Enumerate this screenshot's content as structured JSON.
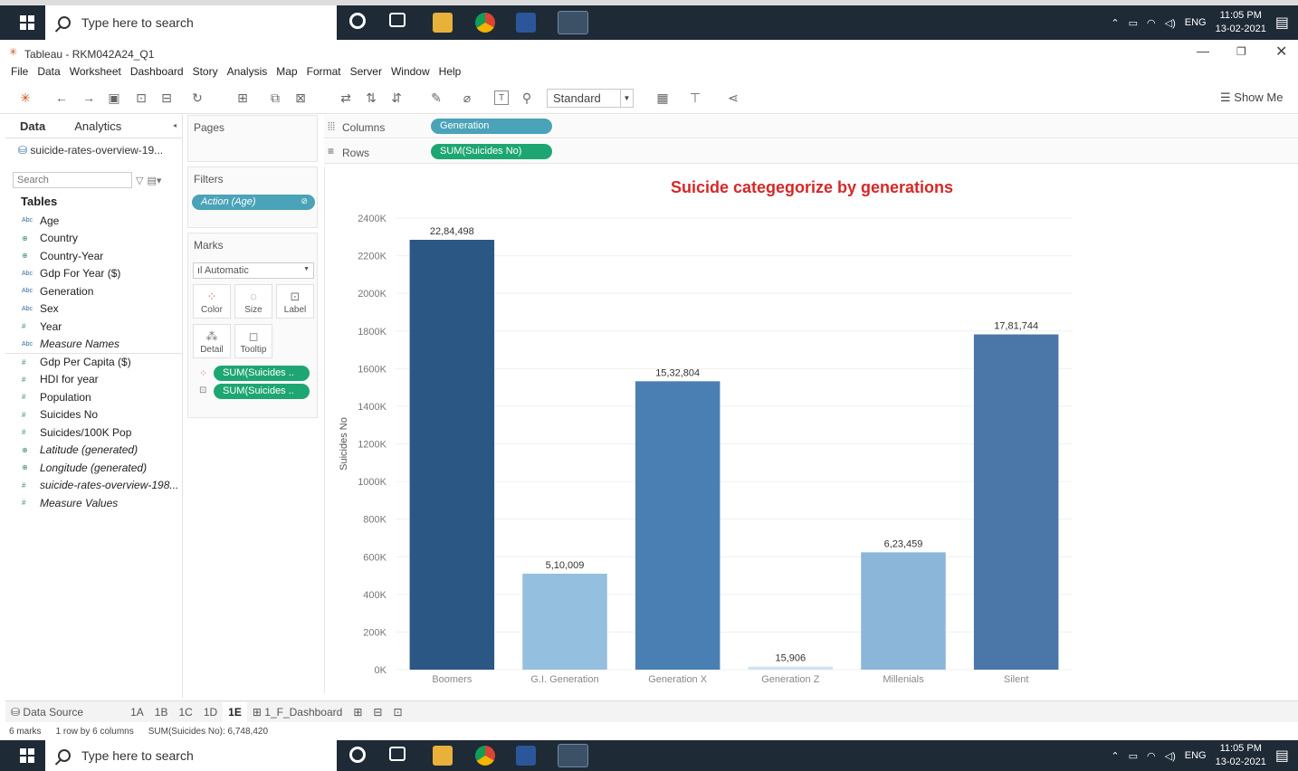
{
  "taskbar": {
    "search_placeholder": "Type here to search",
    "lang": "ENG",
    "time": "11:05 PM",
    "date": "13-02-2021"
  },
  "window": {
    "title": "Tableau - RKM042A24_Q1"
  },
  "menu": [
    "File",
    "Data",
    "Worksheet",
    "Dashboard",
    "Story",
    "Analysis",
    "Map",
    "Format",
    "Server",
    "Window",
    "Help"
  ],
  "toolbar": {
    "fit_select": "Standard",
    "show_me": "Show Me"
  },
  "data_pane": {
    "tab_data": "Data",
    "tab_analytics": "Analytics",
    "source": "suicide-rates-overview-19...",
    "search_placeholder": "Search",
    "tables_heading": "Tables",
    "fields": [
      {
        "type": "Abc",
        "name": "Age"
      },
      {
        "type": "globe",
        "name": "Country"
      },
      {
        "type": "globe",
        "name": "Country-Year"
      },
      {
        "type": "Abc",
        "name": "Gdp For Year ($)"
      },
      {
        "type": "Abc",
        "name": "Generation"
      },
      {
        "type": "Abc",
        "name": "Sex"
      },
      {
        "type": "#",
        "name": "Year"
      },
      {
        "type": "Abc",
        "name": "Measure Names"
      },
      {
        "type": "#",
        "name": "Gdp Per Capita ($)"
      },
      {
        "type": "#",
        "name": "HDI for year"
      },
      {
        "type": "#",
        "name": "Population"
      },
      {
        "type": "#",
        "name": "Suicides No"
      },
      {
        "type": "#",
        "name": "Suicides/100K Pop"
      },
      {
        "type": "globe",
        "name": "Latitude (generated)"
      },
      {
        "type": "globe",
        "name": "Longitude (generated)"
      },
      {
        "type": "#",
        "name": "suicide-rates-overview-198..."
      },
      {
        "type": "#",
        "name": "Measure Values"
      }
    ]
  },
  "shelves": {
    "pages_label": "Pages",
    "filters_label": "Filters",
    "filter_pill": "Action (Age)",
    "marks_label": "Marks",
    "marks_type": "Automatic",
    "mark_buttons": [
      "Color",
      "Size",
      "Label",
      "Detail",
      "Tooltip"
    ],
    "mark_pill_1": "SUM(Suicides ..",
    "mark_pill_2": "SUM(Suicides ..",
    "columns_label": "Columns",
    "rows_label": "Rows",
    "columns_pill": "Generation",
    "rows_pill": "SUM(Suicides No)"
  },
  "chart_data": {
    "type": "bar",
    "title": "Suicide categegorize by generations",
    "ylabel": "Suicides No",
    "xlabel": "",
    "categories": [
      "Boomers",
      "G.I. Generation",
      "Generation X",
      "Generation Z",
      "Millenials",
      "Silent"
    ],
    "values": [
      2284498,
      510009,
      1532804,
      15906,
      623459,
      1781744
    ],
    "value_labels": [
      "22,84,498",
      "5,10,009",
      "15,32,804",
      "15,906",
      "6,23,459",
      "17,81,744"
    ],
    "bar_colors": [
      "#2a5783",
      "#94bfde",
      "#4a7fb3",
      "#cfe3f2",
      "#8bb6da",
      "#4a76a8"
    ],
    "ylim": [
      0,
      2400000
    ],
    "yticks": [
      0,
      200000,
      400000,
      600000,
      800000,
      1000000,
      1200000,
      1400000,
      1600000,
      1800000,
      2000000,
      2200000,
      2400000
    ],
    "ytick_labels": [
      "0K",
      "200K",
      "400K",
      "600K",
      "800K",
      "1000K",
      "1200K",
      "1400K",
      "1600K",
      "1800K",
      "2000K",
      "2200K",
      "2400K"
    ],
    "grid": true,
    "title_color": "#d62728"
  },
  "sheet_tabs": {
    "data_source": "Data Source",
    "sheets": [
      "1A",
      "1B",
      "1C",
      "1D",
      "1E"
    ],
    "dashboard": "1_F_Dashboard"
  },
  "status": {
    "marks": "6 marks",
    "dims": "1 row by 6 columns",
    "sum": "SUM(Suicides No): 6,748,420"
  }
}
